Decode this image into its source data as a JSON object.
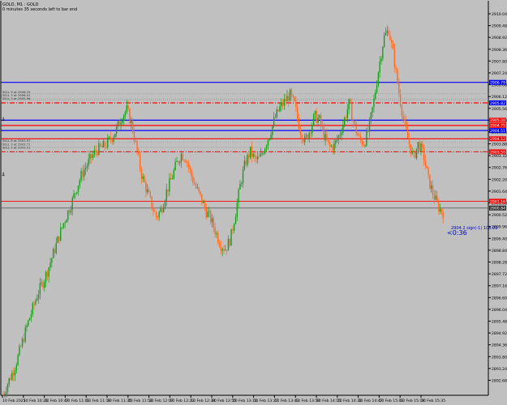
{
  "header": {
    "symbol": "GOLD, M1 : GOLD",
    "timer_note": "0 minutes 35 seconds left to bar end"
  },
  "colors": {
    "background": "#c0c0c0",
    "axis": "#000000",
    "bull": "#1a9e1a",
    "bear": "#ff6a1f",
    "level_red": "#ff0000",
    "level_blue": "#0000ff",
    "dim_line": "#808080"
  },
  "orders": {
    "top_group": [
      "SELL 9 at 2906.25",
      "SELL 3 at 2906.01",
      "SELL 3 at 2905.96"
    ],
    "mid_group": [
      "SELL 6 at 2903.97",
      "SELL 3 at 2903.71",
      "SELL 3 at 2903.51"
    ]
  },
  "markers": {
    "upper_icon": "alert-bell-icon",
    "lower_icon": "alert-bell-icon"
  },
  "price_tags": {
    "blue_top": "2906.79",
    "blue_mid": "2905.82",
    "red_a": "2905.00",
    "red_b": "2904.75",
    "blue_low": "2904.51",
    "red_c": "2904.12",
    "red_d": "2903.50",
    "bid": "2901.16",
    "last": "2900.84"
  },
  "chart_data": {
    "type": "candlestick",
    "title": "GOLD, M1 : GOLD",
    "ylim": [
      2901.8,
      2910.5
    ],
    "yticks": [
      "2910.04",
      "2909.48",
      "2908.92",
      "2908.36",
      "2907.80",
      "2907.24",
      "2906.68",
      "2906.12",
      "2905.56",
      "2905.00",
      "2904.44",
      "2903.88",
      "2903.32",
      "2902.76",
      "2902.20",
      "2901.64",
      "2901.08",
      "2900.52",
      "2899.96",
      "2899.40",
      "2898.84",
      "2898.28",
      "2897.72",
      "2897.16",
      "2896.60",
      "2896.04",
      "2895.48",
      "2894.92",
      "2894.36",
      "2893.80",
      "2893.24",
      "2892.68"
    ],
    "xticks": [
      "10 Feb 2025",
      "10 Feb 10:21",
      "10 Feb 10:47",
      "10 Feb 11:03",
      "10 Feb 11:19",
      "10 Feb 11:35",
      "10 Feb 11:51",
      "10 Feb 12:07",
      "10 Feb 12:23",
      "10 Feb 12:39",
      "10 Feb 12:55",
      "10 Feb 13:11",
      "10 Feb 13:27",
      "10 Feb 13:43",
      "10 Feb 13:59",
      "10 Feb 14:15",
      "10 Feb 14:31",
      "10 Feb 14:47",
      "10 Feb 15:03",
      "10 Feb 15:19",
      "10 Feb 15:35"
    ],
    "path": [
      2892.0,
      2892.6,
      2893.1,
      2893.8,
      2894.6,
      2895.4,
      2896.1,
      2896.8,
      2897.3,
      2897.9,
      2898.6,
      2899.3,
      2900.0,
      2900.6,
      2901.2,
      2901.9,
      2902.5,
      2902.9,
      2903.3,
      2903.6,
      2903.7,
      2903.9,
      2904.2,
      2904.6,
      2905.2,
      2905.5,
      2904.8,
      2903.6,
      2902.4,
      2901.7,
      2901.0,
      2900.4,
      2900.8,
      2901.6,
      2902.2,
      2902.9,
      2903.4,
      2903.2,
      2902.4,
      2901.8,
      2901.3,
      2900.7,
      2900.3,
      2899.7,
      2899.1,
      2898.9,
      2899.4,
      2900.6,
      2902.0,
      2903.0,
      2903.5,
      2903.1,
      2903.2,
      2903.8,
      2904.4,
      2905.1,
      2905.6,
      2905.9,
      2906.2,
      2905.7,
      2904.6,
      2904.0,
      2904.5,
      2905.2,
      2905.0,
      2904.2,
      2903.7,
      2903.8,
      2904.3,
      2905.0,
      2905.8,
      2904.8,
      2904.1,
      2903.9,
      2904.6,
      2905.9,
      2907.5,
      2908.9,
      2909.3,
      2908.0,
      2906.4,
      2905.0,
      2904.0,
      2903.2,
      2903.9,
      2903.4,
      2902.2,
      2901.5,
      2900.9,
      2900.6
    ],
    "levels": [
      {
        "price": 2906.79,
        "color": "blue",
        "style": "solid"
      },
      {
        "price": 2905.82,
        "color": "red",
        "style": "dashdot"
      },
      {
        "price": 2905.0,
        "color": "blue",
        "style": "solid"
      },
      {
        "price": 2904.75,
        "color": "red",
        "style": "solid"
      },
      {
        "price": 2904.51,
        "color": "blue",
        "style": "solid"
      },
      {
        "price": 2904.12,
        "color": "red",
        "style": "solid"
      },
      {
        "price": 2903.5,
        "color": "red",
        "style": "dashdot"
      },
      {
        "price": 2901.16,
        "color": "red",
        "style": "thin"
      },
      {
        "price": 2900.84,
        "color": "gray",
        "style": "thin"
      }
    ]
  },
  "bid_label": "2904.2 sign(-1) 108.99",
  "countdown": "<0:36"
}
